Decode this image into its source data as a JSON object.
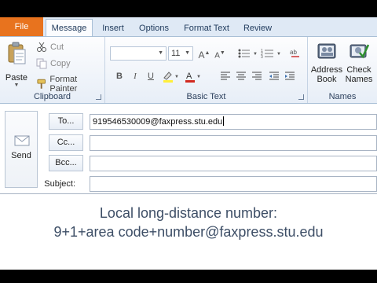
{
  "tabs": {
    "file": "File",
    "message": "Message",
    "insert": "Insert",
    "options": "Options",
    "format_text": "Format Text",
    "review": "Review"
  },
  "clipboard": {
    "paste": "Paste",
    "cut": "Cut",
    "copy": "Copy",
    "format_painter": "Format Painter",
    "group_label": "Clipboard"
  },
  "basic_text": {
    "font_size": "11",
    "group_label": "Basic Text",
    "bold": "B",
    "italic": "I",
    "underline": "U",
    "grow_font": "A",
    "shrink_font": "A"
  },
  "names": {
    "address_book_line1": "Address",
    "address_book_line2": "Book",
    "check_names_line1": "Check",
    "check_names_line2": "Names",
    "group_label": "Names"
  },
  "header": {
    "send": "Send",
    "to_button": "To...",
    "cc_button": "Cc...",
    "bcc_button": "Bcc...",
    "subject_label": "Subject:",
    "to_value": "919546530009@faxpress.stu.edu",
    "cc_value": "",
    "bcc_value": "",
    "subject_value": ""
  },
  "body": {
    "line1": "Local long-distance number:",
    "line2": "9+1+area code+number@faxpress.stu.edu"
  },
  "colors": {
    "file_tab": "#e8731e",
    "ribbon_bg": "#e7eef7",
    "body_text": "#3d4e66"
  }
}
